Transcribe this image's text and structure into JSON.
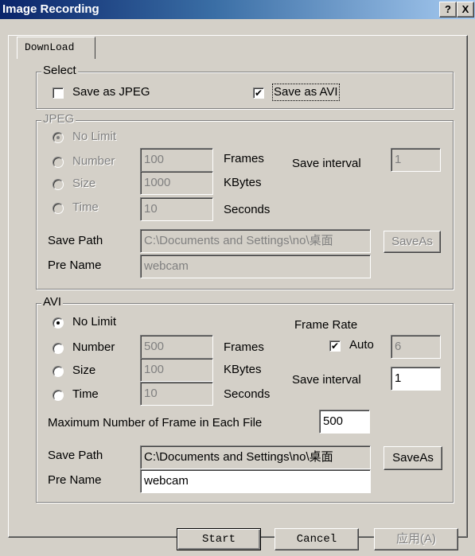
{
  "window": {
    "title": "Image Recording",
    "help_btn": "?",
    "close_btn": "X"
  },
  "tab": {
    "label": "DownLoad"
  },
  "select": {
    "legend": "Select",
    "save_jpeg": {
      "label": "Save as JPEG",
      "checked": false
    },
    "save_avi": {
      "label": "Save as AVI",
      "checked": true
    }
  },
  "jpeg": {
    "legend": "JPEG",
    "no_limit": "No Limit",
    "number": "Number",
    "size": "Size",
    "time": "Time",
    "number_value": "100",
    "size_value": "1000",
    "time_value": "10",
    "frames_unit": "Frames",
    "kbytes_unit": "KBytes",
    "seconds_unit": "Seconds",
    "save_interval_label": "Save interval",
    "save_interval_value": "1",
    "save_path_label": "Save Path",
    "save_path_value": "C:\\Documents and Settings\\no\\桌面",
    "saveas_label": "SaveAs",
    "pre_name_label": "Pre Name",
    "pre_name_value": "webcam"
  },
  "avi": {
    "legend": "AVI",
    "no_limit": "No Limit",
    "number": "Number",
    "size": "Size",
    "time": "Time",
    "number_value": "500",
    "size_value": "100",
    "time_value": "10",
    "frames_unit": "Frames",
    "kbytes_unit": "KBytes",
    "seconds_unit": "Seconds",
    "frame_rate_label": "Frame Rate",
    "auto_label": "Auto",
    "auto_checked": true,
    "frame_rate_value": "6",
    "save_interval_label": "Save interval",
    "save_interval_value": "1",
    "max_frames_label": "Maximum Number of Frame in Each File",
    "max_frames_value": "500",
    "save_path_label": "Save Path",
    "save_path_value": "C:\\Documents and Settings\\no\\桌面",
    "saveas_label": "SaveAs",
    "pre_name_label": "Pre Name",
    "pre_name_value": "webcam"
  },
  "footer": {
    "start_label": "Start",
    "cancel_label": "Cancel",
    "apply_label": "应用(A)"
  }
}
